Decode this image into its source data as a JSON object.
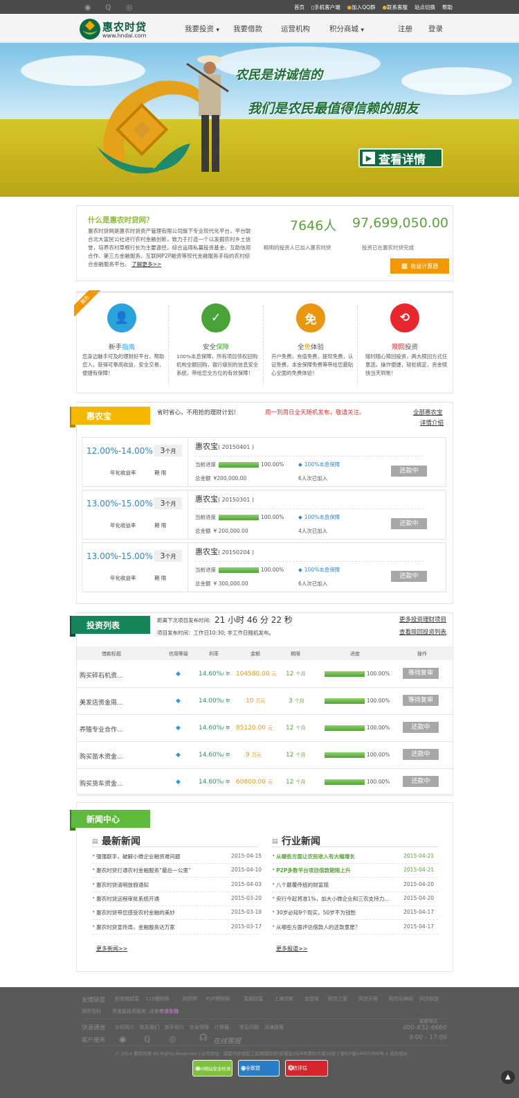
{
  "topbar": {
    "links": [
      "首页",
      "手机客户端",
      "加入QQ群",
      "联系客服",
      "站点切换",
      "帮助"
    ]
  },
  "brand": {
    "name": "惠农时贷",
    "url": "www.hndai.com"
  },
  "nav": {
    "items": [
      "我要投资",
      "我要借款",
      "运营机构",
      "积分商城"
    ],
    "register": "注册",
    "login": "登录"
  },
  "banner": {
    "slogan1": "农民是讲诚信的",
    "slogan2": "我们是农民最值得信赖的朋友",
    "button": "查看详情"
  },
  "intro": {
    "title": "什么是惠农时贷网？",
    "body": "惠农时贷网是惠农时贷资产管理有限公司旗下专业现代化平台，平台联合北大富民公社进行农村金融创新，致力于打造一个以发掘农村乡土信誉，培养农村草根行长为主要途径，综合运用私募投资基金、互助信用合作、第三方金融服务、互联网P2P融资等现代金融服务手段的农村综合金融服务平台。",
    "more": "了解更多>>",
    "investors_value": "7646人",
    "investors_label": "精明的投资人已加入惠农时贷",
    "amount_value": "97,699,050.00",
    "amount_label": "投资已在惠农时贷完成",
    "calc_button": "收益计算器"
  },
  "services": {
    "ribbon": "服务",
    "items": [
      {
        "pre": "新手",
        "hl": "指南",
        "post": "",
        "hl_color": "#2aa3dd",
        "color": "#2aa3dd",
        "icon": "user-icon",
        "glyph": "👤",
        "desc": "您身边触手可及的理财好平台，帮助您入，获得可靠高收益，安全交易，便捷有保障！"
      },
      {
        "pre": "安全",
        "hl": "保障",
        "post": "",
        "hl_color": "#4aa338",
        "color": "#4aa338",
        "icon": "check-icon",
        "glyph": "✓",
        "desc": "100%本息保障，所有项目债权回购机构全额回购，银行级别的信息安全系统，带给您全方位的有效保障！"
      },
      {
        "pre": "全",
        "hl": "免",
        "post": "体验",
        "hl_color": "#e8950f",
        "color": "#e8950f",
        "icon": "free-icon",
        "glyph": "免",
        "desc": "开户免费，充值免费，提现免费，认证免费，本金保障免费等带给您最贴心全面的免费体验！"
      },
      {
        "pre": "",
        "hl": "赎回",
        "post": "投资",
        "hl_color": "#e8262d",
        "color": "#e8262d",
        "icon": "redeem-icon",
        "glyph": "⟲",
        "desc": "随时随心赎回投资，两大赎回方式任意选，操作便捷，轻松搞定，资金赎快当天到账！"
      }
    ]
  },
  "huinongbao": {
    "tag": "惠农宝",
    "slogan": "省时省心，不用抢的理财计划！",
    "notice": "周一到周日全天随机发布，敬请关注。",
    "all_link": "全部惠农宝",
    "detail_link": "详情介绍",
    "rate_label": "年化收益率",
    "term_label": "期 限",
    "progress_label": "当前进度",
    "guarantee": "100%本息保障",
    "total_label": "总金额",
    "products": [
      {
        "rate": "12.00%-14.00%",
        "term": "3",
        "unit": "个月",
        "name": "惠农宝",
        "code": "( 20150401 )",
        "progress": 100,
        "progress_text": "100.00%",
        "total": "¥200,000.00",
        "people": "6人次已加入",
        "status": "还款中"
      },
      {
        "rate": "13.00%-15.00%",
        "term": "3",
        "unit": "个月",
        "name": "惠农宝",
        "code": "( 20150301 )",
        "progress": 100,
        "progress_text": "100.00%",
        "total": "¥ 200,000.00",
        "people": "4人次已加入",
        "status": "还款中"
      },
      {
        "rate": "13.00%-15.00%",
        "term": "3",
        "unit": "个月",
        "name": "惠农宝",
        "code": "( 20150204 )",
        "progress": 100,
        "progress_text": "100.00%",
        "total": "¥ 300,000.00",
        "people": "6人次已加入",
        "status": "还款中"
      }
    ]
  },
  "investlist": {
    "tag": "投资列表",
    "countdown_label": "距离下次项目发布时间:",
    "countdown": "21 小时 46 分 22 秒",
    "release_info": "项目发布时间：工作日10:30; 非工作日随机发布。",
    "more1": "更多投资理财项目",
    "more2": "查看赎回投资列表",
    "headers": [
      "借款标题",
      "信用等级",
      "利率",
      "金额",
      "期限",
      "进度",
      "操作"
    ],
    "rows": [
      {
        "title": "购买碎石机资...",
        "rate": "14.60%",
        "per": "/ 年",
        "amount": "104580.00",
        "amount_unit": "元",
        "term": "12",
        "term_unit": "个月",
        "progress": 100,
        "progress_text": "100.00%",
        "action": "等待复审"
      },
      {
        "title": "美发店资金周...",
        "rate": "14.00%",
        "per": "/ 年",
        "amount": "10",
        "amount_unit": "万元",
        "term": "3",
        "term_unit": "个月",
        "progress": 100,
        "progress_text": "100.00%",
        "action": "等待复审"
      },
      {
        "title": "养殖专业合作...",
        "rate": "14.60%",
        "per": "/ 年",
        "amount": "85120.00",
        "amount_unit": "元",
        "term": "12",
        "term_unit": "个月",
        "progress": 100,
        "progress_text": "100.00%",
        "action": "还款中"
      },
      {
        "title": "购买苗木资金...",
        "rate": "14.60%",
        "per": "/ 年",
        "amount": "9",
        "amount_unit": "万元",
        "term": "12",
        "term_unit": "个月",
        "progress": 100,
        "progress_text": "100.00%",
        "action": "还款中"
      },
      {
        "title": "购买货车资金...",
        "rate": "14.60%",
        "per": "/ 年",
        "amount": "60800.00",
        "amount_unit": "元",
        "term": "12",
        "term_unit": "个月",
        "progress": 100,
        "progress_text": "100.00%",
        "action": "还款中"
      }
    ]
  },
  "news": {
    "tag": "新闻中心",
    "latest_title": "最新新闻",
    "industry_title": "行业新闻",
    "latest": [
      {
        "title": "强强联手，破解小微企业融资难问题",
        "date": "2015-04-15"
      },
      {
        "title": "惠农时贷打通农村金融服务“最后一公里”",
        "date": "2015-04-10"
      },
      {
        "title": "惠农时贷清明放假通知",
        "date": "2015-04-03"
      },
      {
        "title": "惠农时贷远程审批系统开通",
        "date": "2015-03-20"
      },
      {
        "title": "惠农时贷带您感受农村金融的美妙",
        "date": "2015-03-19"
      },
      {
        "title": "惠农时贷宣传周，金融服务达万家",
        "date": "2015-03-17"
      }
    ],
    "industry": [
      {
        "title": "从哪些方面让农民收入有大幅增长",
        "date": "2015-04-21",
        "highlight": true
      },
      {
        "title": "P2P多数平台项目借款期限上升",
        "date": "2015-04-21",
        "highlight": true
      },
      {
        "title": "八个颠覆传统的财富观",
        "date": "2015-04-20",
        "highlight": false
      },
      {
        "title": "央行今起将准1%，加大小微企业和三农支持力...",
        "date": "2015-04-20",
        "highlight": false
      },
      {
        "title": "30岁必知9个现实，50岁不为钱愁",
        "date": "2015-04-17",
        "highlight": false
      },
      {
        "title": "从哪些方面评估借款人的还款意愿？",
        "date": "2015-04-17",
        "highlight": false
      }
    ],
    "more_latest": "更多新闻>>",
    "more_industry": "更多报道>>"
  },
  "footer": {
    "friend_label": "友情链接",
    "friends": [
      "新浪微财富",
      "115理财网",
      "网贷帮",
      "P2P理财网",
      "富丽财富",
      "上海贷款",
      "金管家",
      "网贷之家",
      "网贷天眼",
      "网贷经典网",
      "网贷联盟",
      "网贷百科",
      "贵金属投资服务",
      "成都七洲生物"
    ],
    "apply": "申请友链",
    "quick_label": "快速通道",
    "quick": [
      "公司简介",
      "联系我们",
      "新手指引",
      "安全保障",
      "计算器",
      "常见问题",
      "法律政策"
    ],
    "service_label": "客户服务",
    "online": "在线客服",
    "hotline_label": "客服电话",
    "hotline": "400-832-6660",
    "hours": "9:00 - 17:00",
    "copyright": "© 2014 惠农时贷 All Rights Reserved  |  公司地址：成都市武侯区工区网城华府(新城区)624号南科大域18层  |  蜀ICP备14001005号-1 站长统计",
    "badges": [
      "360网站安全检测",
      "安全联盟",
      "可信评估"
    ]
  }
}
